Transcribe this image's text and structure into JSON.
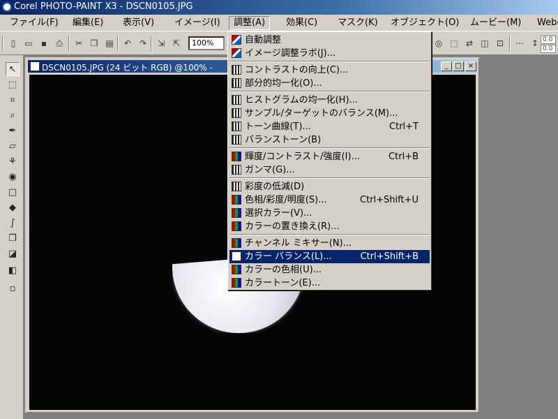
{
  "window": {
    "title": "Corel PHOTO-PAINT X3 - DSCN0105.JPG"
  },
  "menubar": {
    "items": [
      {
        "label": "ファイル(F)"
      },
      {
        "label": "編集(E)"
      },
      {
        "label": "表示(V)"
      },
      {
        "label": "イメージ(I)"
      },
      {
        "label": "調整(A)"
      },
      {
        "label": "効果(C)"
      },
      {
        "label": "マスク(K)"
      },
      {
        "label": "オブジェクト(O)"
      },
      {
        "label": "ムービー(M)"
      },
      {
        "label": "Web("
      }
    ]
  },
  "toolbar": {
    "zoom_value": "100%",
    "mini_fields": [
      "0.0",
      "0.0"
    ]
  },
  "document": {
    "title": "DSCN0105.JPG (24 ビット RGB) @100% -",
    "buttons": [
      "_",
      "□",
      "×"
    ]
  },
  "adjust_menu": {
    "items": [
      {
        "label": "自動調整",
        "shortcut": ""
      },
      {
        "label": "イメージ調整ラボ(J)...",
        "shortcut": ""
      },
      {
        "label": "コントラストの向上(C)...",
        "shortcut": ""
      },
      {
        "label": "部分的均一化(O)...",
        "shortcut": ""
      },
      {
        "label": "ヒストグラムの均一化(H)...",
        "shortcut": ""
      },
      {
        "label": "サンプル/ターゲットのバランス(M)...",
        "shortcut": ""
      },
      {
        "label": "トーン曲線(T)...",
        "shortcut": "Ctrl+T"
      },
      {
        "label": "バランストーン(B)",
        "shortcut": ""
      },
      {
        "label": "輝度/コントラスト/強度(I)...",
        "shortcut": "Ctrl+B"
      },
      {
        "label": "ガンマ(G)...",
        "shortcut": ""
      },
      {
        "label": "彩度の低減(D)",
        "shortcut": ""
      },
      {
        "label": "色相/彩度/明度(S)...",
        "shortcut": "Ctrl+Shift+U"
      },
      {
        "label": "選択カラー(V)...",
        "shortcut": ""
      },
      {
        "label": "カラーの置き換え(R)...",
        "shortcut": ""
      },
      {
        "label": "チャンネル ミキサー(N)...",
        "shortcut": ""
      },
      {
        "label": "カラー バランス(L)...",
        "shortcut": "Ctrl+Shift+B"
      },
      {
        "label": "カラーの色相(U)...",
        "shortcut": ""
      },
      {
        "label": "カラートーン(E)...",
        "shortcut": ""
      }
    ]
  }
}
